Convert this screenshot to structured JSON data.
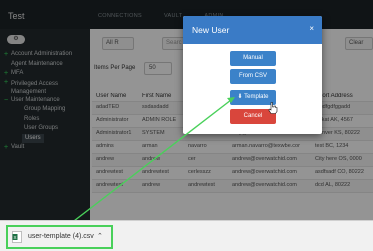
{
  "app": {
    "title": "Test"
  },
  "topnav": [
    "CONNECTIONS",
    "VAULT",
    "ADMIN"
  ],
  "sidebar": {
    "items": [
      {
        "label": "Account Administration",
        "level": 0,
        "expandable": true
      },
      {
        "label": "Agent Maintenance",
        "level": 0,
        "expandable": false
      },
      {
        "label": "MFA",
        "level": 0,
        "expandable": true
      },
      {
        "label": "Privileged Access Management",
        "level": 0,
        "expandable": true
      },
      {
        "label": "User Maintenance",
        "level": 0,
        "expandable": true
      },
      {
        "label": "Group Mapping",
        "level": 1,
        "expandable": false
      },
      {
        "label": "Roles",
        "level": 1,
        "expandable": false
      },
      {
        "label": "User Groups",
        "level": 1,
        "expandable": false
      },
      {
        "label": "Users",
        "level": 1,
        "expandable": false,
        "active": true
      },
      {
        "label": "Vault",
        "level": 0,
        "expandable": true
      }
    ]
  },
  "toolbar": {
    "filter_value": "All R",
    "search_placeholder": "Searc",
    "clear_label": "Clear"
  },
  "paging": {
    "label": "Items Per Page",
    "value": "50"
  },
  "table": {
    "columns": [
      "User Name",
      "First Name",
      "",
      "",
      "Short Address"
    ],
    "rows": [
      [
        "adadTED",
        "ssdasdadd",
        "",
        "",
        "dfgdfgdfggadd"
      ],
      [
        "Administrator",
        "ADMIN ROLE",
        "",
        "",
        "Bekat AK, 4567"
      ],
      [
        "Administrator1",
        "SYSTEM",
        "ADMIN",
        "ciay@overwatchid.com",
        "Denver KS, 80222"
      ],
      [
        "admins",
        "arman",
        "navarro",
        "arman.navarro@texwbe.com",
        "test BC, 1234"
      ],
      [
        "andrew",
        "andrew",
        "cer",
        "andrew@overwatchid.com",
        "City here OS, 0000"
      ],
      [
        "andrewtest",
        "andrewtest",
        "cerlesszz",
        "andrew@overwatchid.com",
        "asdfsadf CO, 80222"
      ],
      [
        "andrewtest",
        "andrew",
        "andrewtest",
        "andrew@overwatchid.com",
        "dcd AL, 80222"
      ]
    ]
  },
  "modal": {
    "title": "New User",
    "close": "×",
    "buttons": {
      "manual": "Manual",
      "from_csv": "From CSV",
      "template": "Template",
      "cancel": "Cancel"
    }
  },
  "download": {
    "filename": "user-template (4).csv",
    "caret": "⌃"
  },
  "colors": {
    "accent": "#3a7bc6",
    "danger": "#d9463c",
    "highlight": "#49d05a",
    "sidebar": "#242a2d"
  },
  "icons": [
    "gear-icon",
    "download-icon",
    "csv-file-icon",
    "close-icon",
    "chevron-up-icon",
    "hand-cursor-icon"
  ]
}
